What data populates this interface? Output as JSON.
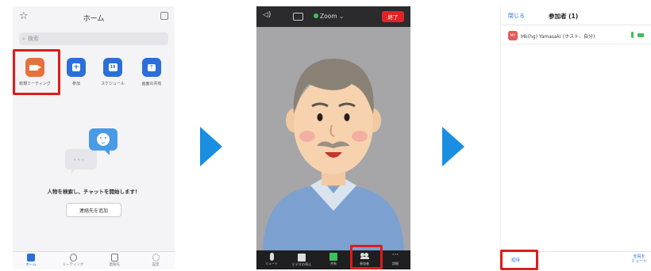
{
  "home_screen": {
    "title": "ホーム",
    "search_placeholder": "検索",
    "actions": [
      {
        "label": "新規ミーティング",
        "icon": "video-camera-icon",
        "color": "#e8713a"
      },
      {
        "label": "参加",
        "icon": "plus-icon",
        "color": "#2b6fd8"
      },
      {
        "label": "スケジュール",
        "icon": "calendar-icon",
        "color": "#2b6fd8"
      },
      {
        "label": "画面の共有",
        "icon": "share-up-icon",
        "color": "#2b6fd8"
      }
    ],
    "calendar_day": "19",
    "prompt_text": "人物を検索し、チャットを開始します！",
    "add_contact_label": "連絡先を追加",
    "tabs": [
      {
        "label": "ホーム",
        "icon": "chat-icon",
        "active": true
      },
      {
        "label": "ミーティング",
        "icon": "clock-icon",
        "active": false
      },
      {
        "label": "連絡先",
        "icon": "contacts-icon",
        "active": false
      },
      {
        "label": "設定",
        "icon": "gear-icon",
        "active": false
      }
    ]
  },
  "meeting_screen": {
    "app_label": "Zoom",
    "end_label": "終了",
    "controls": [
      {
        "label": "ミュート",
        "icon": "microphone-icon"
      },
      {
        "label": "ビデオの停止",
        "icon": "video-icon"
      },
      {
        "label": "共有",
        "icon": "share-screen-icon"
      },
      {
        "label": "参加者",
        "icon": "participants-icon"
      },
      {
        "label": "詳細",
        "icon": "more-icon"
      }
    ]
  },
  "participants_screen": {
    "close_label": "閉じる",
    "title": "参加者 (1)",
    "participant": {
      "initials": "MY",
      "name": "Mk(hg) Yamasaki (ホスト、自分)"
    },
    "invite_label": "招待",
    "mute_all_label": "全員を\nミュート"
  },
  "colors": {
    "highlight": "#e01b1b",
    "arrow": "#1a8ee0",
    "accent": "#2b6fd8"
  }
}
